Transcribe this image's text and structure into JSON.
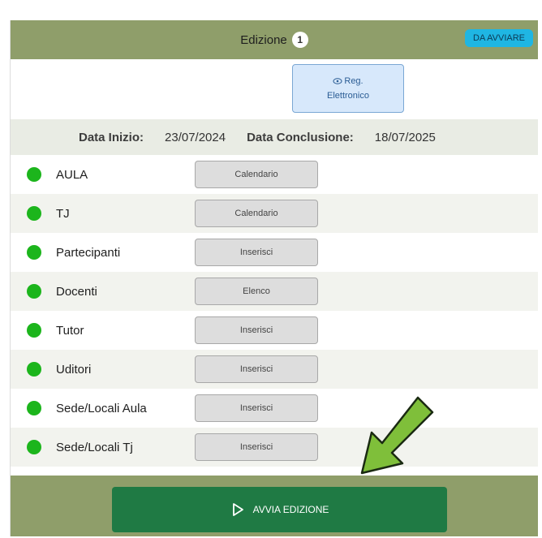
{
  "header": {
    "title": "Edizione",
    "count": "1",
    "status": "DA AVVIARE"
  },
  "register_button": {
    "line1": "Reg.",
    "line2": "Elettronico",
    "icon": "eye-icon"
  },
  "dates": {
    "start_label": "Data Inizio:",
    "start_value": "23/07/2024",
    "end_label": "Data Conclusione:",
    "end_value": "18/07/2025"
  },
  "rows": [
    {
      "label": "AULA",
      "button": "Calendario"
    },
    {
      "label": "TJ",
      "button": "Calendario"
    },
    {
      "label": "Partecipanti",
      "button": "Inserisci"
    },
    {
      "label": "Docenti",
      "button": "Elenco"
    },
    {
      "label": "Tutor",
      "button": "Inserisci"
    },
    {
      "label": "Uditori",
      "button": "Inserisci"
    },
    {
      "label": "Sede/Locali Aula",
      "button": "Inserisci"
    },
    {
      "label": "Sede/Locali Tj",
      "button": "Inserisci"
    }
  ],
  "footer": {
    "start_label": "AVVIA EDIZIONE",
    "start_icon": "play-outline-icon"
  },
  "colors": {
    "header_bg": "#8f9e6a",
    "status_badge": "#1fb6e3",
    "status_dot": "#1cb51c",
    "start_button": "#1f7a44",
    "annotation_arrow": "#7fbf3a"
  }
}
